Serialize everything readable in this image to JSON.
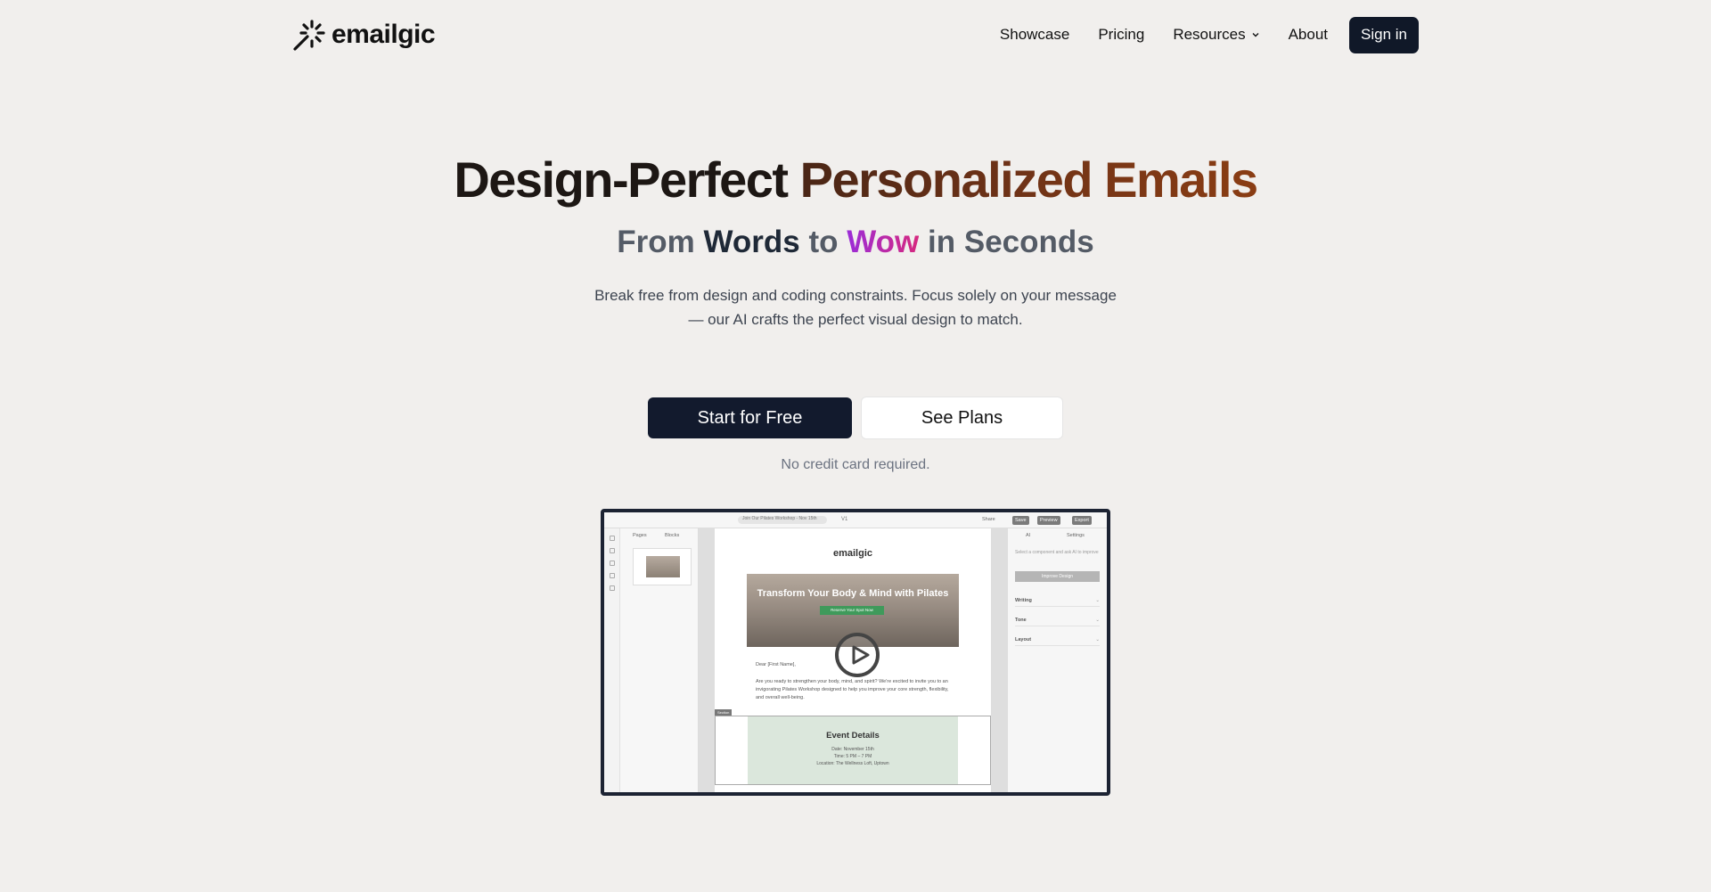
{
  "header": {
    "logo_text": "emailgic",
    "nav": [
      {
        "label": "Showcase"
      },
      {
        "label": "Pricing"
      },
      {
        "label": "Resources"
      },
      {
        "label": "About"
      }
    ],
    "signin_label": "Sign in"
  },
  "hero": {
    "title_part1": "Design-Perfect",
    "title_part2": "Personalized Emails",
    "subtitle": {
      "w1": "From",
      "w2": "Words",
      "w3": "to",
      "w4": "Wow",
      "w5": "in Seconds"
    },
    "description": "Break free from design and coding constraints. Focus solely on your message — our AI crafts the perfect visual design to match.",
    "cta_primary": "Start for Free",
    "cta_secondary": "See Plans",
    "note": "No credit card required."
  },
  "preview": {
    "top_title": "Join Our Pilates Workshop - Nov 15th",
    "version": "V1",
    "share": "Share",
    "save": "Save",
    "preview": "Preview",
    "export": "Export",
    "tab_pages": "Pages",
    "tab_blocks": "Blocks",
    "email_logo": "emailgic",
    "hero_text": "Transform Your Body & Mind with Pilates",
    "hero_button": "Reserve Your Spot Now",
    "greeting": "Dear [First Name],",
    "body": "Are you ready to strengthen your body, mind, and spirit? We're excited to invite you to an invigorating Pilates Workshop designed to help you improve your core strength, flexibility, and overall well-being.",
    "section_tag": "Section",
    "event_title": "Event Details",
    "event_date": "Date: November 15th",
    "event_time": "Time: 5 PM – 7 PM",
    "event_location": "Location: The Wellness Loft, Uptown",
    "right_tab_ai": "AI",
    "right_tab_settings": "Settings",
    "right_hint": "Select a component and ask AI to improve",
    "right_button": "Improve Design",
    "accordions": [
      {
        "label": "Writing"
      },
      {
        "label": "Tone"
      },
      {
        "label": "Layout"
      }
    ]
  },
  "colors": {
    "background": "#f1efed",
    "primary_button": "#121a2d",
    "title_gradient_start": "#4a2616",
    "title_gradient_end": "#8a3d14",
    "wow_gradient_start": "#9b2dd8",
    "wow_gradient_end": "#d6287f"
  }
}
